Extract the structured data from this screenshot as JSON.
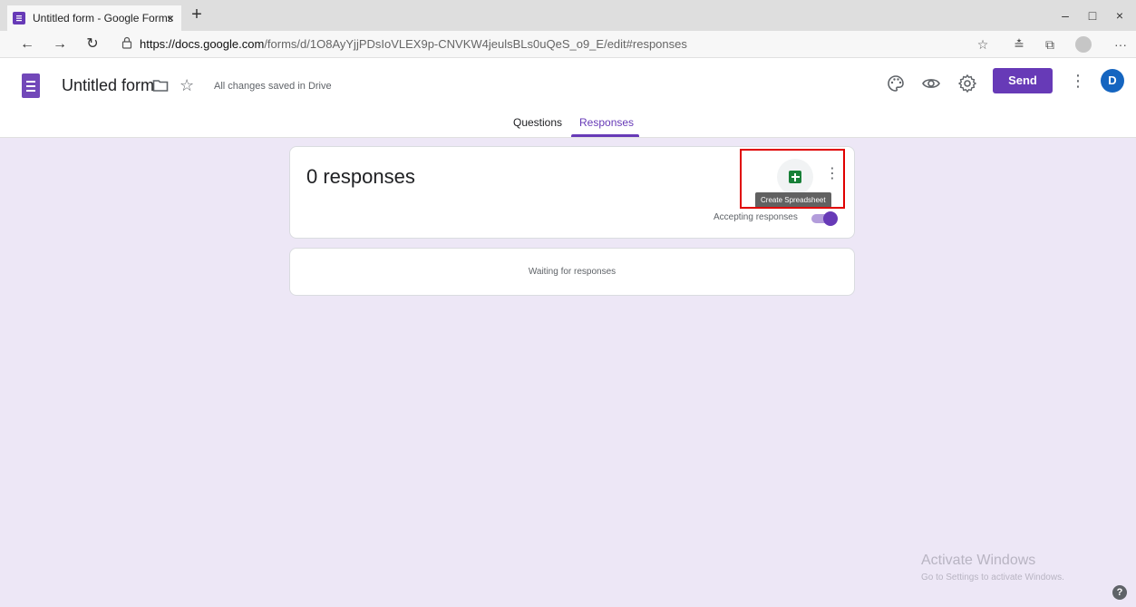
{
  "browser": {
    "tab_title": "Untitled form - Google Forms",
    "tab_close": "×",
    "new_tab": "+",
    "url_host": "https://docs.google.com",
    "url_path": "/forms/d/1O8AyYjjPDsIoVLEX9p-CNVKW4jeulsBLs0uQeS_o9_E/edit#responses",
    "nav": {
      "back": "←",
      "forward": "→",
      "refresh": "↻"
    },
    "window_controls": {
      "minimize": "–",
      "maximize": "□",
      "close": "×"
    },
    "toolbar": {
      "favorite": "☆",
      "favorites_list": "≛",
      "collections": "⧉",
      "more": "···"
    }
  },
  "form_header": {
    "title": "Untitled form",
    "star": "☆",
    "saved_status": "All changes saved in Drive",
    "send_label": "Send",
    "more": "⋮",
    "avatar_initial": "D"
  },
  "form_tabs": [
    {
      "label": "Questions",
      "active": false
    },
    {
      "label": "Responses",
      "active": true
    }
  ],
  "responses": {
    "count_text": "0 responses",
    "more": "⋮",
    "sheets_tooltip": "Create Spreadsheet",
    "accepting_label": "Accepting responses",
    "accepting": true,
    "waiting_text": "Waiting for responses"
  },
  "watermark": {
    "title": "Activate Windows",
    "subtitle": "Go to Settings to activate Windows."
  },
  "help": "?",
  "colors": {
    "accent": "#673ab7",
    "background": "#ede7f6",
    "sheets_green": "#188038",
    "highlight_red": "#e00000"
  }
}
